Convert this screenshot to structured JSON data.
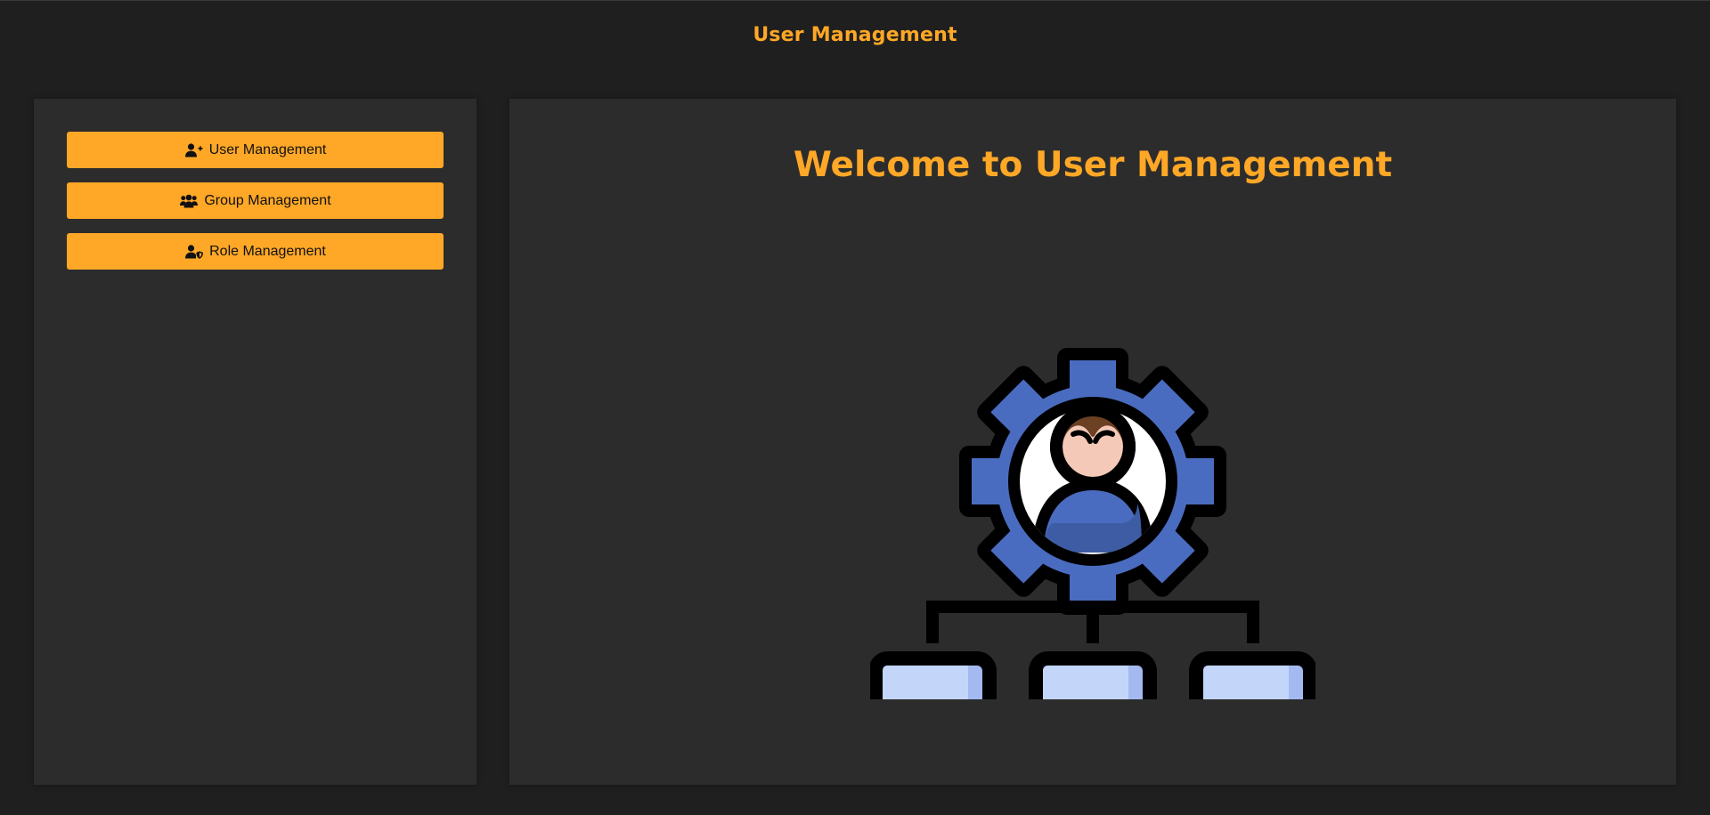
{
  "header": {
    "title": "User Management"
  },
  "sidebar": {
    "items": [
      {
        "label": "User Management",
        "icon": "user-plus-icon"
      },
      {
        "label": "Group Management",
        "icon": "users-group-icon"
      },
      {
        "label": "Role Management",
        "icon": "user-shield-icon"
      }
    ]
  },
  "main": {
    "welcome_title": "Welcome to User Management",
    "illustration": "user-gear-hierarchy-icon"
  },
  "colors": {
    "background": "#1f1f1f",
    "panel": "#2c2c2c",
    "accent": "#ffa726",
    "gear_blue": "#4a6cc0",
    "box_light": "#c3d6fa",
    "box_shade": "#a3b9f0"
  }
}
